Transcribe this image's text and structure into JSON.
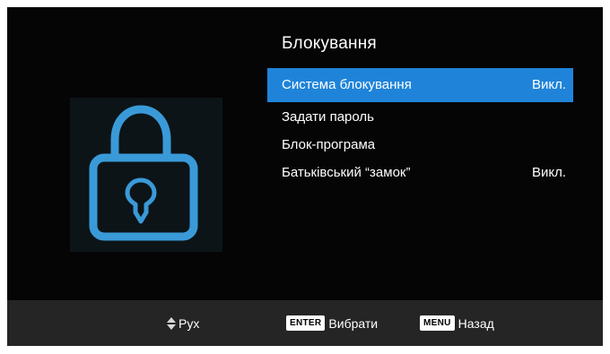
{
  "menu": {
    "title": "Блокування",
    "items": [
      {
        "label": "Система блокування",
        "value": "Викл.",
        "selected": true
      },
      {
        "label": "Задати пароль",
        "value": "",
        "selected": false
      },
      {
        "label": "Блок-програма",
        "value": "",
        "selected": false
      },
      {
        "label": "Батьківський “замок”",
        "value": "Викл.",
        "selected": false
      }
    ]
  },
  "footer": {
    "move_label": "Рух",
    "enter_key": "ENTER",
    "enter_label": "Вибрати",
    "menu_key": "MENU",
    "menu_label": "Назад"
  },
  "icons": {
    "lock": "lock-icon",
    "move": "up-down-arrows-icon"
  },
  "colors": {
    "selection": "#1f84d9",
    "lock_stroke": "#3a9ad8",
    "background": "#050505",
    "footer": "#252525"
  }
}
